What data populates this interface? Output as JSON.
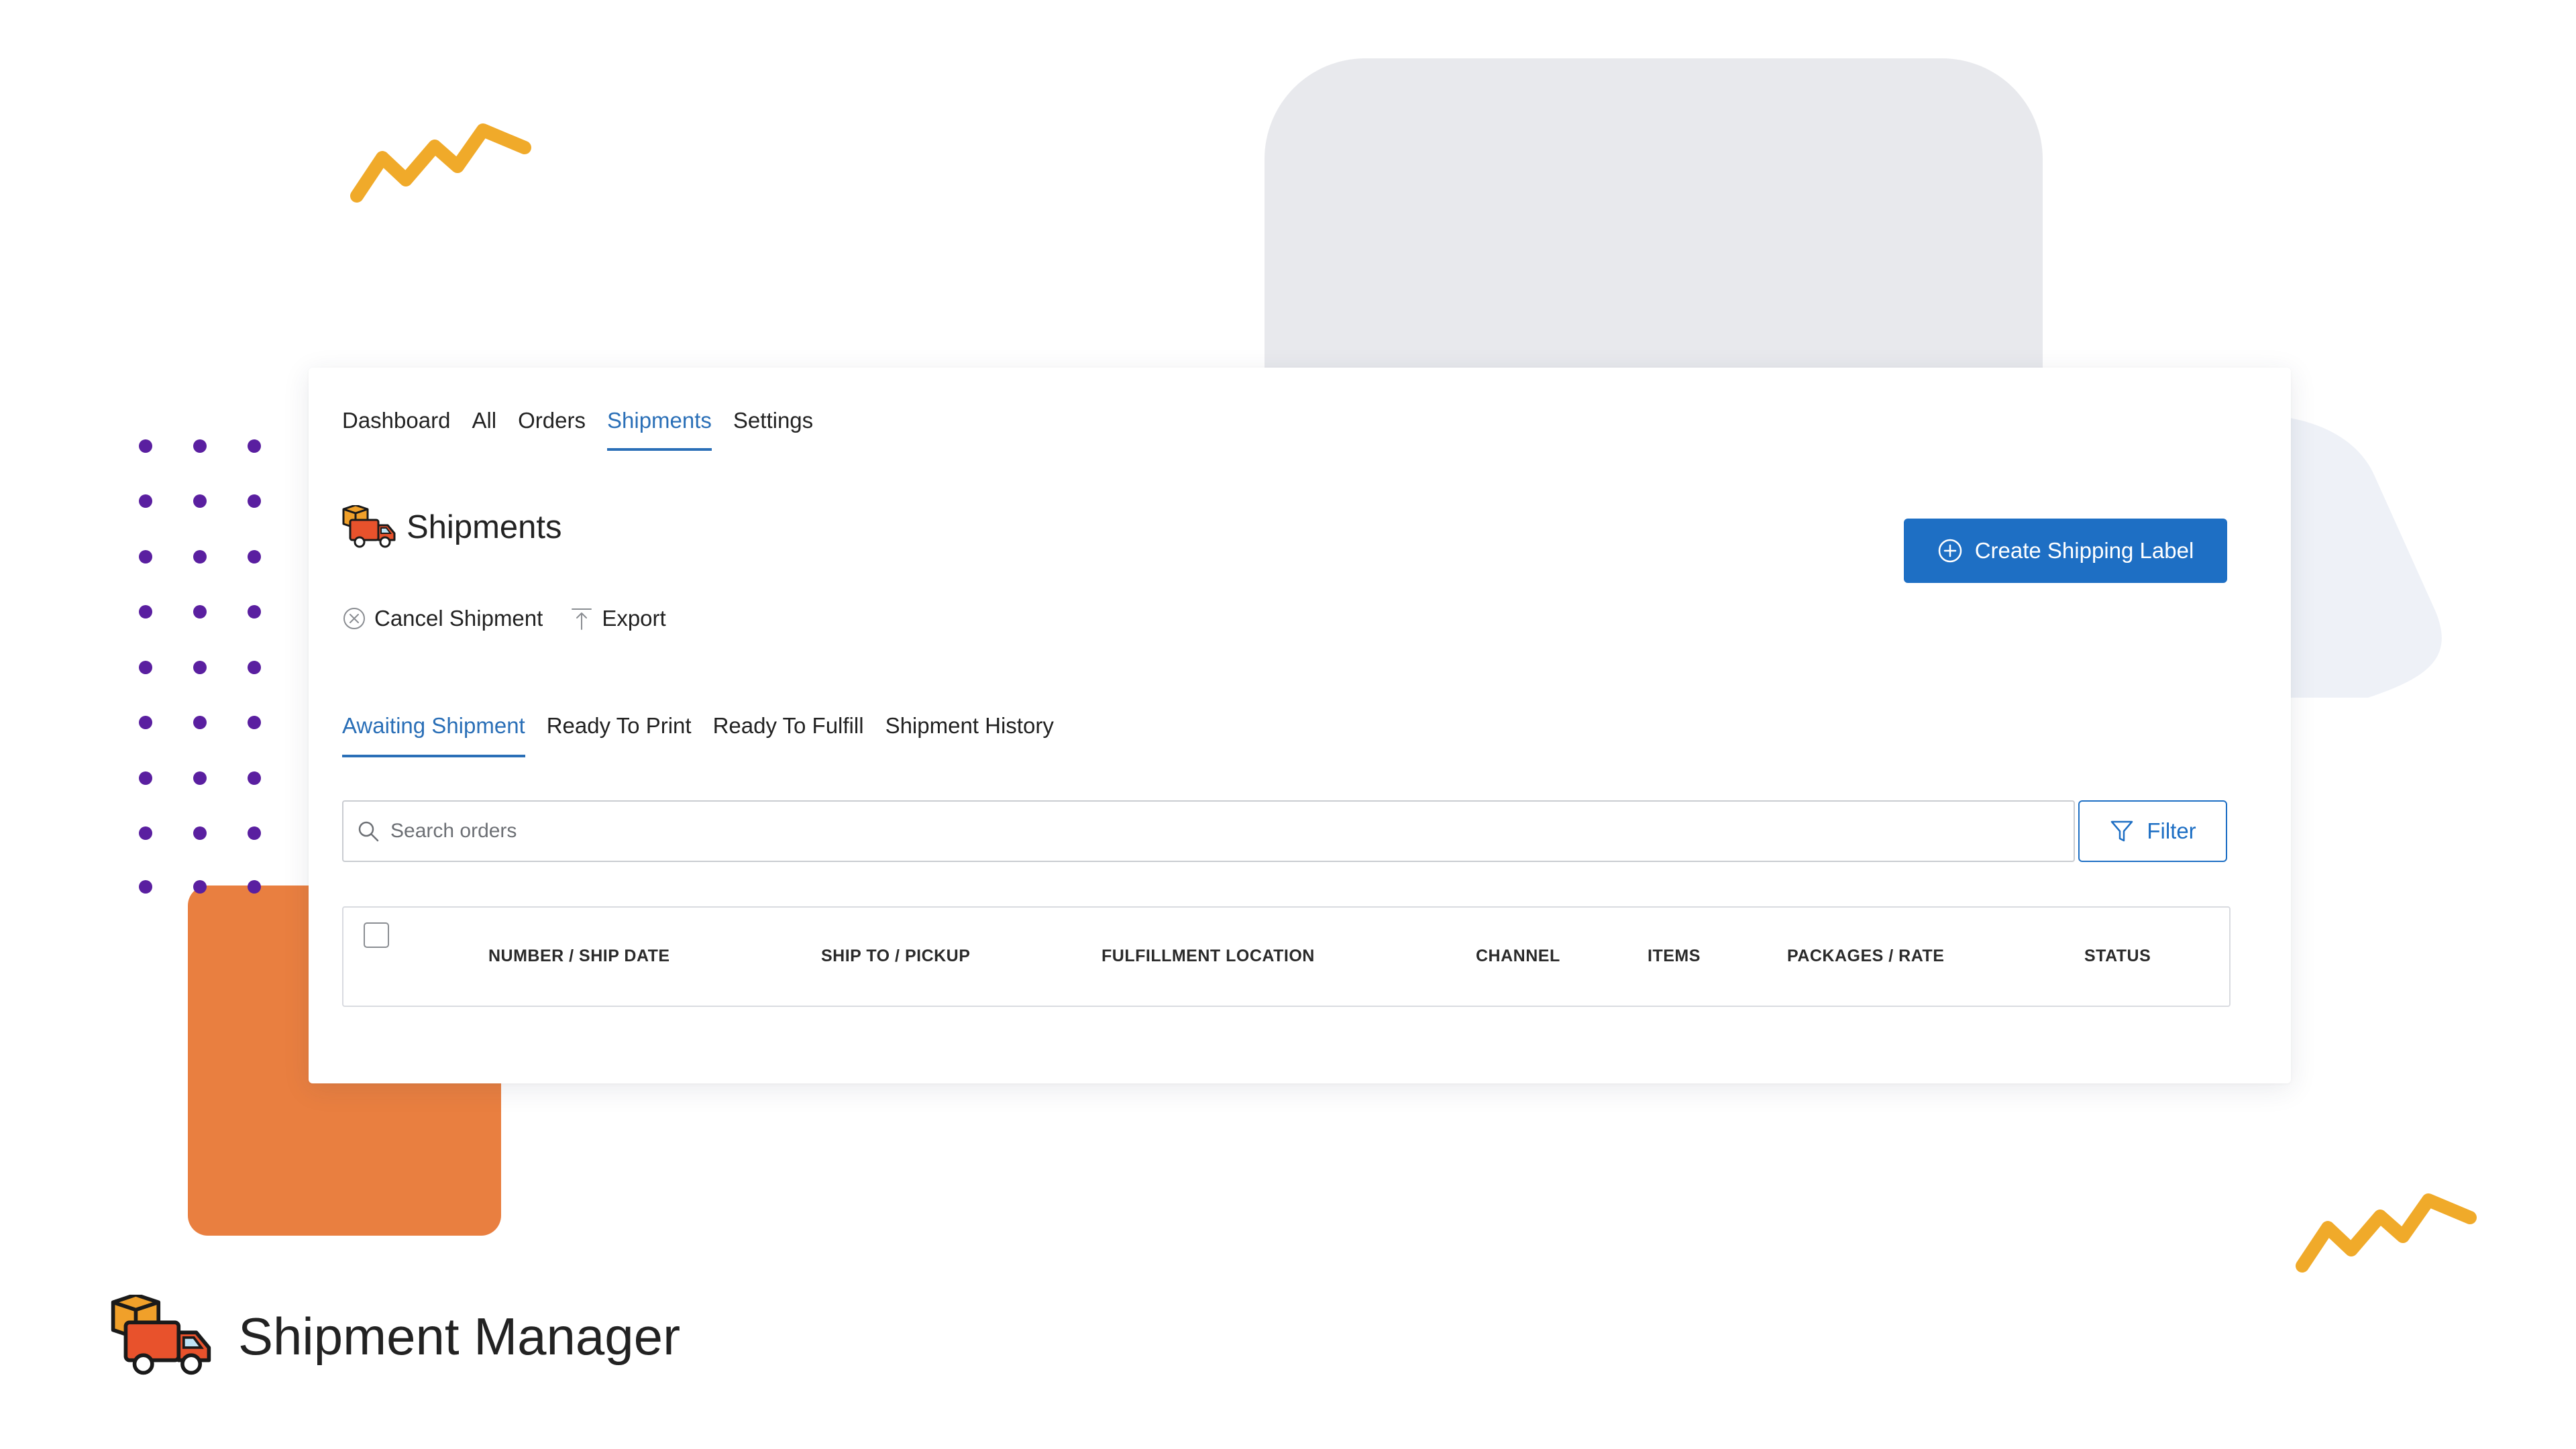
{
  "top_nav": {
    "items": [
      {
        "label": "Dashboard",
        "active": false
      },
      {
        "label": "All",
        "active": false
      },
      {
        "label": "Orders",
        "active": false
      },
      {
        "label": "Shipments",
        "active": true
      },
      {
        "label": "Settings",
        "active": false
      }
    ]
  },
  "page": {
    "title": "Shipments",
    "title_icon": "delivery-truck-icon"
  },
  "create_button": {
    "label": "Create Shipping Label",
    "icon": "plus-circle-icon"
  },
  "actions": {
    "cancel": {
      "label": "Cancel Shipment",
      "icon": "x-circle-icon"
    },
    "export": {
      "label": "Export",
      "icon": "export-icon"
    }
  },
  "sub_tabs": [
    {
      "label": "Awaiting Shipment",
      "active": true
    },
    {
      "label": "Ready To Print",
      "active": false
    },
    {
      "label": "Ready To Fulfill",
      "active": false
    },
    {
      "label": "Shipment History",
      "active": false
    }
  ],
  "search": {
    "placeholder": "Search orders",
    "icon": "search-icon"
  },
  "filter": {
    "label": "Filter",
    "icon": "filter-icon"
  },
  "table": {
    "columns": [
      "NUMBER / SHIP DATE",
      "SHIP TO / PICKUP",
      "FULFILLMENT LOCATION",
      "CHANNEL",
      "ITEMS",
      "PACKAGES / RATE",
      "STATUS"
    ],
    "rows": []
  },
  "brand": {
    "name": "Shipment Manager",
    "logo": "delivery-truck-logo"
  },
  "colors": {
    "accent": "#1e6fc4",
    "active_tab": "#2a6fb7",
    "orange": "#e97f40",
    "zigzag": "#f0aa2a",
    "dots": "#5a1fa0",
    "gray_shape": "#e8e9ed"
  }
}
